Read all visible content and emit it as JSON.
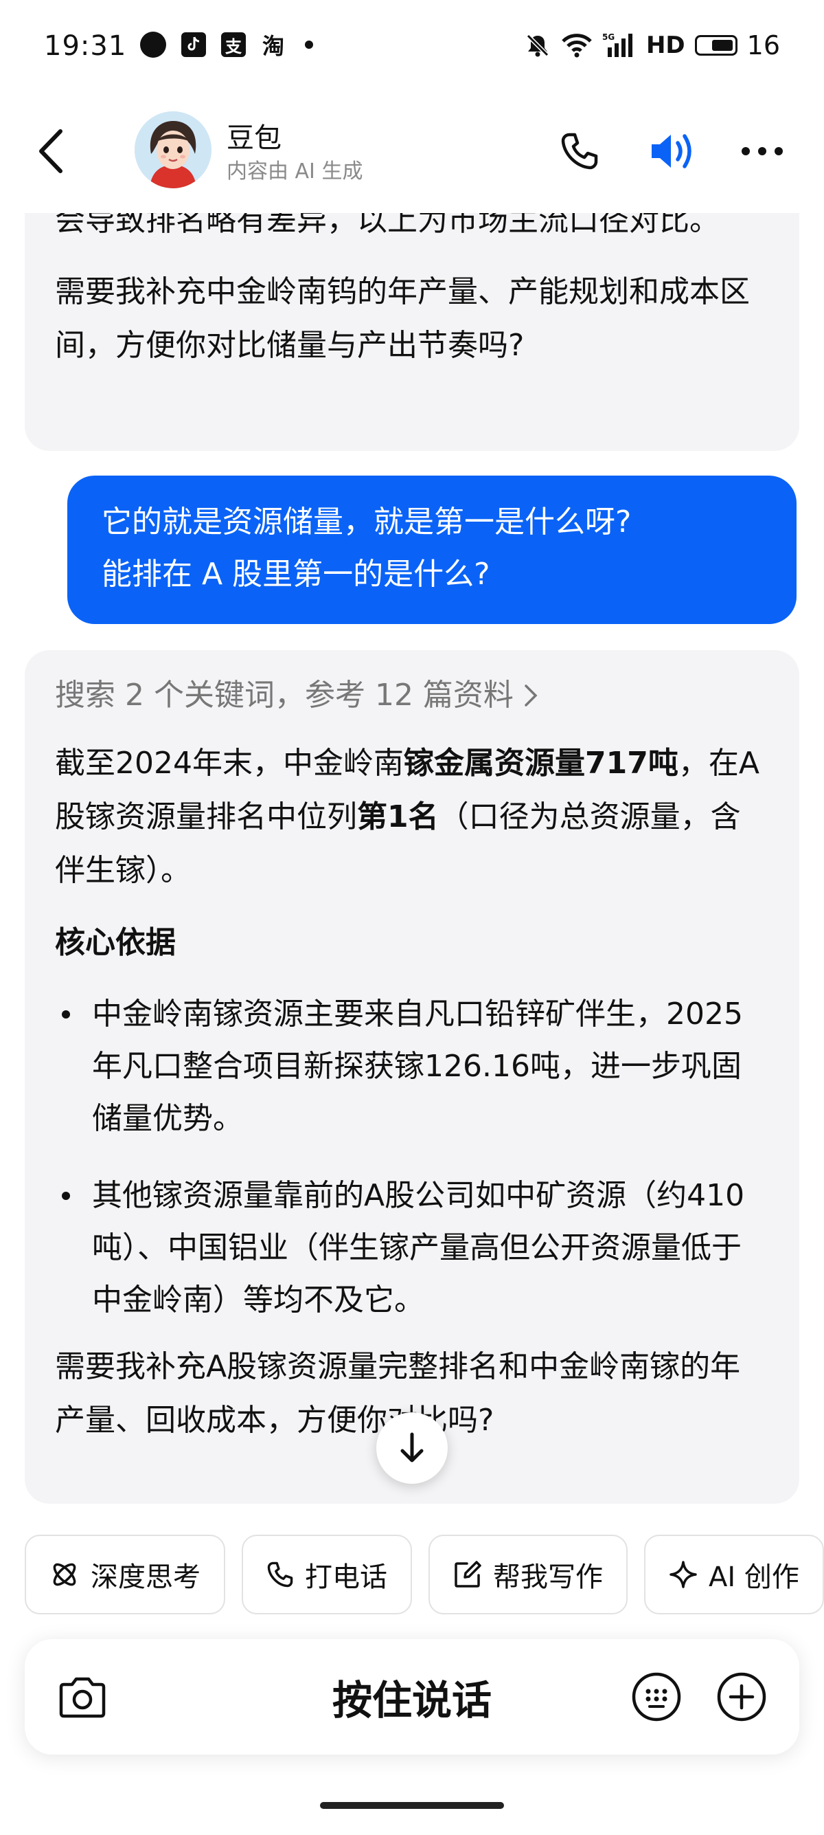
{
  "status_bar": {
    "time": "19:31",
    "app_icons": [
      "bubble-icon",
      "tiktok-icon",
      "alipay-icon",
      "taobao-icon"
    ],
    "alipay_glyph": "支",
    "taobao_glyph": "淘",
    "hd": "HD",
    "battery": "16"
  },
  "header": {
    "name": "豆包",
    "subtitle": "内容由 AI 生成",
    "speaker_color": "#0a63f6"
  },
  "messages": {
    "bot_prev": {
      "p1": "会导致排名略有差异，以上为市场主流口径对比。",
      "p2": "需要我补充中金岭南钨的年产量、产能规划和成本区间，方便你对比储量与产出节奏吗?"
    },
    "user": {
      "line1": "它的就是资源储量，就是第一是什么呀?",
      "line2": "能排在 A 股里第一的是什么?"
    },
    "bot_answer": {
      "search_ref": "搜索 2 个关键词，参考 12 篇资料",
      "intro_1": "截至2024年末，中金岭南",
      "intro_bold_1": "镓金属资源量717吨",
      "intro_2": "，在A股镓资源量排名中位列",
      "intro_bold_2": "第1名",
      "intro_3": "（口径为总资源量，含伴生镓）。",
      "core_title": "核心依据",
      "bullet_1": "中金岭南镓资源主要来自凡口铅锌矿伴生，2025年凡口整合项目新探获镓126.16吨，进一步巩固储量优势。",
      "bullet_2": "其他镓资源量靠前的A股公司如中矿资源（约410吨）、中国铝业（伴生镓产量高但公开资源量低于中金岭南）等均不及它。",
      "closing": "需要我补充A股镓资源量完整排名和中金岭南镓的年产量、回收成本，方便你对比吗?"
    }
  },
  "quick_actions": [
    {
      "label": "深度思考",
      "icon": "atom-icon"
    },
    {
      "label": "打电话",
      "icon": "phone-icon"
    },
    {
      "label": "帮我写作",
      "icon": "edit-icon"
    },
    {
      "label": "AI 创作",
      "icon": "sparkle-icon"
    }
  ],
  "input": {
    "hold_to_talk": "按住说话"
  },
  "colors": {
    "accent": "#0a63f6",
    "bubble_bg": "#f4f4f6"
  }
}
